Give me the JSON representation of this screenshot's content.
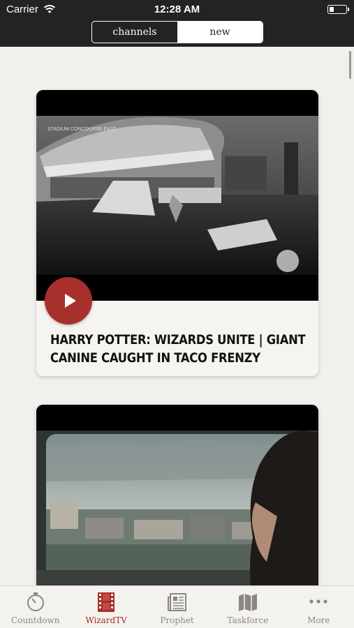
{
  "status_bar": {
    "carrier": "Carrier",
    "time": "12:28 AM"
  },
  "segmented_control": {
    "options": [
      "channels",
      "new"
    ],
    "selected": "new"
  },
  "feed": {
    "items": [
      {
        "overlay_text": "STADIUM CONCOURSE EAST",
        "title": "HARRY POTTER: WIZARDS UNITE | GIANT CANINE CAUGHT IN TACO FRENZY"
      },
      {
        "overlay_text": "",
        "title": ""
      }
    ]
  },
  "tab_bar": {
    "selected": "WizardTV",
    "items": [
      {
        "label": "Countdown",
        "icon": "stopwatch-icon"
      },
      {
        "label": "WizardTV",
        "icon": "film-strip-icon"
      },
      {
        "label": "Prophet",
        "icon": "newspaper-icon"
      },
      {
        "label": "Taskforce",
        "icon": "map-icon"
      },
      {
        "label": "More",
        "icon": "ellipsis-icon"
      }
    ]
  },
  "colors": {
    "accent": "#a8302c",
    "bar": "#232323",
    "background": "#f2f0ed"
  }
}
